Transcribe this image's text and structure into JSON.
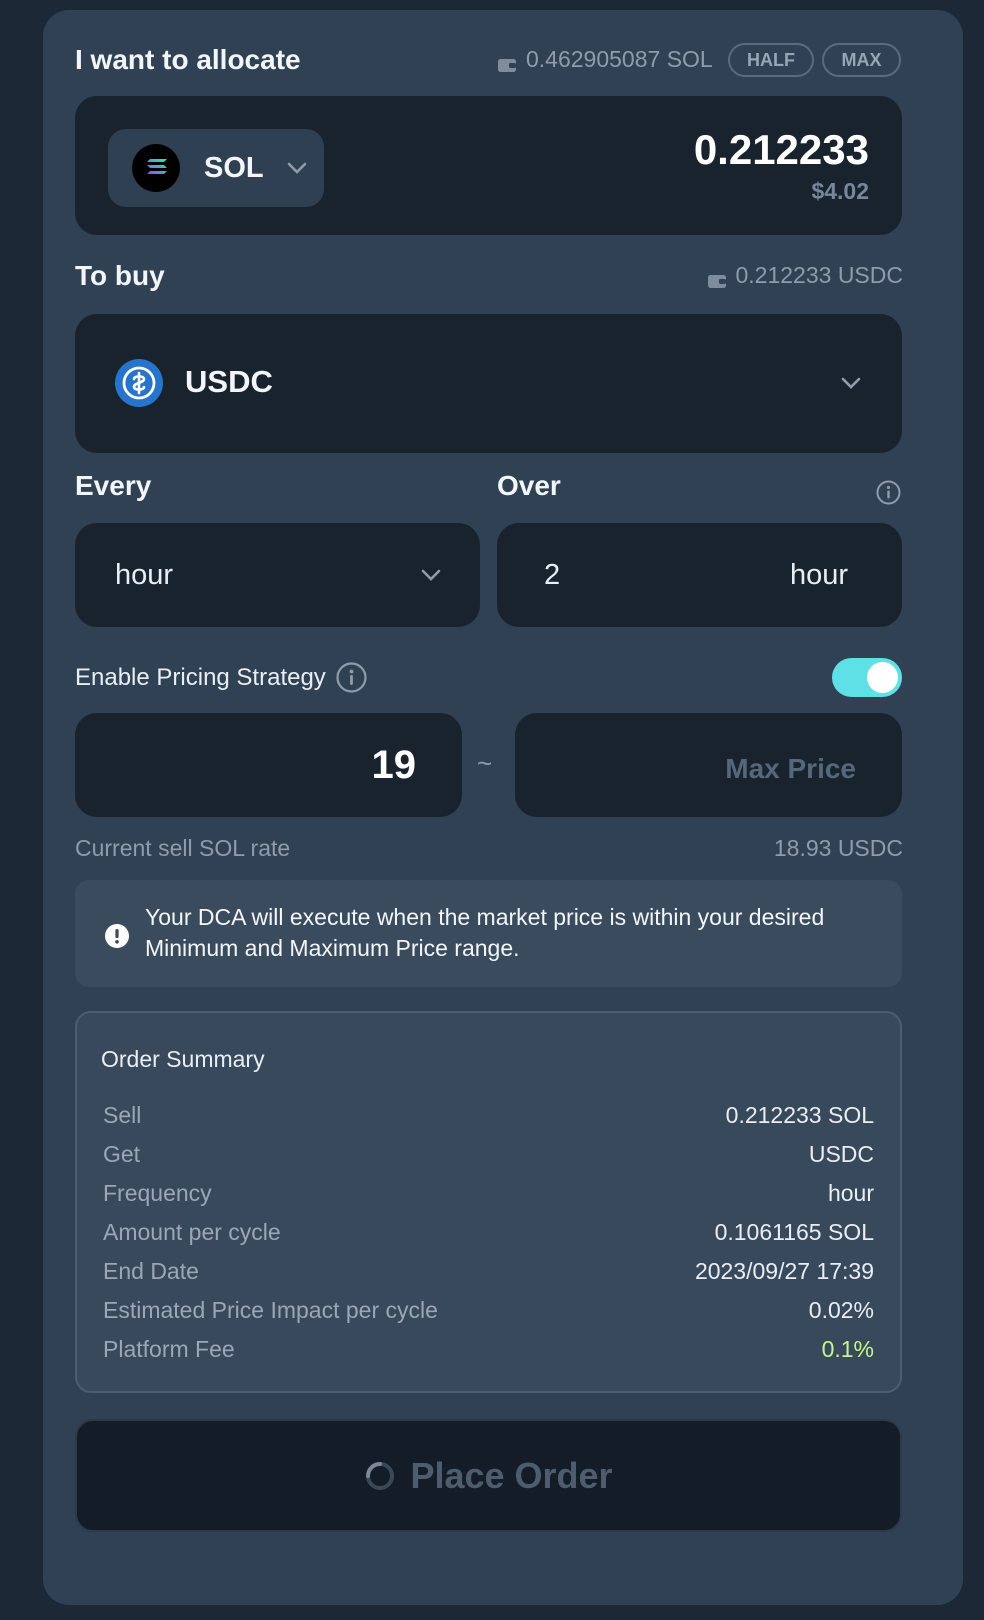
{
  "allocate": {
    "title": "I want to allocate",
    "balance": "0.462905087 SOL",
    "half_label": "HALF",
    "max_label": "MAX",
    "token": "SOL",
    "amount": "0.212233",
    "usd_value": "$4.02"
  },
  "buy": {
    "title": "To buy",
    "balance": "0.212233 USDC",
    "token": "USDC"
  },
  "every": {
    "title": "Every",
    "value": "hour"
  },
  "over": {
    "title": "Over",
    "count": "2",
    "unit": "hour"
  },
  "pricing": {
    "label": "Enable Pricing Strategy",
    "enabled": true,
    "min_price": "19",
    "separator": "~",
    "max_placeholder": "Max Price",
    "rate_label": "Current sell SOL rate",
    "rate_value": "18.93 USDC"
  },
  "notice": {
    "text": "Your DCA will execute when the market price is within your desired Minimum and Maximum Price range."
  },
  "summary": {
    "title": "Order Summary",
    "rows": [
      {
        "label": "Sell",
        "value": "0.212233 SOL"
      },
      {
        "label": "Get",
        "value": "USDC"
      },
      {
        "label": "Frequency",
        "value": "hour"
      },
      {
        "label": "Amount per cycle",
        "value": "0.1061165 SOL"
      },
      {
        "label": "End Date",
        "value": "2023/09/27 17:39"
      },
      {
        "label": "Estimated Price Impact per cycle",
        "value": "0.02%"
      },
      {
        "label": "Platform Fee",
        "value": "0.1%"
      }
    ]
  },
  "place_order": {
    "label": "Place Order"
  },
  "colors": {
    "accent_toggle": "#5ee0e6",
    "fee_green": "#c5f58c",
    "usdc_blue": "#2775ca"
  },
  "icons": [
    "wallet-icon",
    "sol-logo-icon",
    "chevron-down-icon",
    "usdc-logo-icon",
    "info-icon",
    "alert-icon",
    "spinner-icon"
  ]
}
